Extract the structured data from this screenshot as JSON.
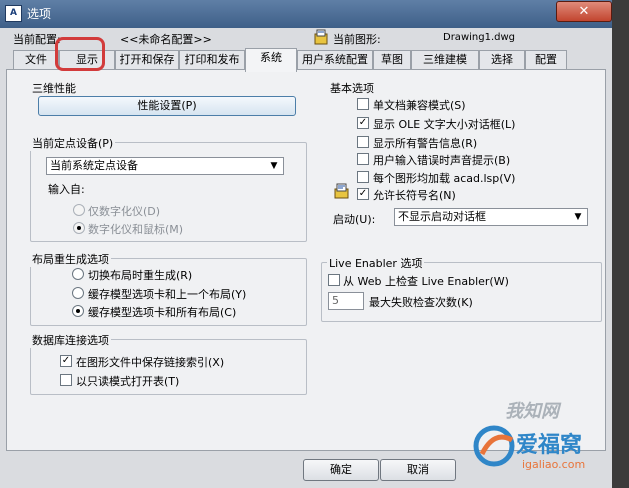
{
  "window": {
    "title": "选项",
    "close_symbol": "✕"
  },
  "profile": {
    "current_profile_label": "当前配置:",
    "current_profile_value": "<<未命名配置>>",
    "current_drawing_label": "当前图形:",
    "current_drawing_value": "Drawing1.dwg"
  },
  "tabs": [
    "文件",
    "显示",
    "打开和保存",
    "打印和发布",
    "系统",
    "用户系统配置",
    "草图",
    "三维建模",
    "选择",
    "配置"
  ],
  "active_tab": "系统",
  "perf3d": {
    "title": "三维性能",
    "button": "性能设置(P)"
  },
  "pointing": {
    "title": "当前定点设备(P)",
    "device_value": "当前系统定点设备",
    "accept_from_label": "输入自:",
    "options": [
      "仅数字化仪(D)",
      "数字化仪和鼠标(M)"
    ],
    "selected_index": 1
  },
  "layout_regen": {
    "title": "布局重生成选项",
    "options": [
      "切换布局时重生成(R)",
      "缓存模型选项卡和上一个布局(Y)",
      "缓存模型选项卡和所有布局(C)"
    ],
    "selected_index": 2
  },
  "db_connect": {
    "title": "数据库连接选项",
    "options": [
      "在图形文件中保存链接索引(X)",
      "以只读模式打开表(T)"
    ],
    "checked": [
      true,
      false
    ]
  },
  "general": {
    "title": "基本选项",
    "options": [
      "单文档兼容模式(S)",
      "显示 OLE 文字大小对话框(L)",
      "显示所有警告信息(R)",
      "用户输入错误时声音提示(B)",
      "每个图形均加载 acad.lsp(V)",
      "允许长符号名(N)"
    ],
    "checked": [
      false,
      true,
      false,
      false,
      false,
      true
    ],
    "startup_label": "启动(U):",
    "startup_value": "不显示启动对话框"
  },
  "live_enabler": {
    "title": "Live Enabler 选项",
    "check_label": "从 Web 上检查 Live Enabler(W)",
    "checked": false,
    "max_attempts_value": "5",
    "max_attempts_label": "最大失败检查次数(K)"
  },
  "footer": {
    "ok": "确定",
    "cancel": "取消"
  },
  "watermark": {
    "top_text": "我知网",
    "logo_text": "爱福窝",
    "site": "igaliao.com"
  }
}
